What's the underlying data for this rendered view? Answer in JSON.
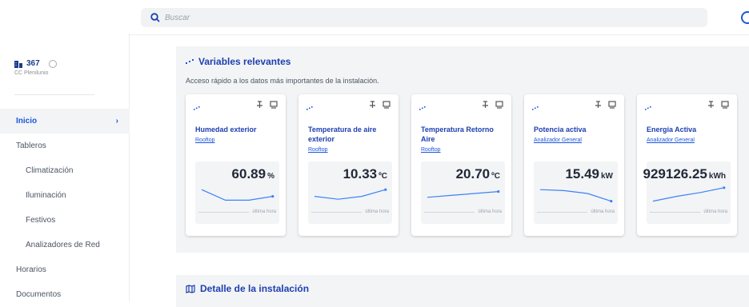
{
  "search": {
    "placeholder": "Buscar"
  },
  "site": {
    "number": "367",
    "name": "CC Plenilunio"
  },
  "nav": {
    "items": [
      {
        "label": "Inicio",
        "chevron": "›"
      },
      {
        "label": "Tableros"
      },
      {
        "label": "Climatización"
      },
      {
        "label": "Iluminación"
      },
      {
        "label": "Festivos"
      },
      {
        "label": "Analizadores de Red"
      },
      {
        "label": "Horarios"
      },
      {
        "label": "Documentos"
      }
    ]
  },
  "relevant": {
    "title": "Variables relevantes",
    "subtitle": "Acceso rápido a los datos más importantes de la instalación.",
    "cards": [
      {
        "title": "Humedad exterior",
        "link": "Rooftop",
        "value": "60.89",
        "unit": "%",
        "footer": "última hora",
        "trend": [
          0.7,
          0.15,
          0.15,
          0.35
        ]
      },
      {
        "title": "Temperatura de aire exterior",
        "link": "Rooftop",
        "value": "10.33",
        "unit": "ºC",
        "footer": "última hora",
        "trend": [
          0.35,
          0.2,
          0.35,
          0.7
        ]
      },
      {
        "title": "Temperatura Retorno Aire",
        "link": "Rooftop",
        "value": "20.70",
        "unit": "ºC",
        "footer": "última hora",
        "trend": [
          0.3,
          0.4,
          0.5,
          0.6
        ]
      },
      {
        "title": "Potencia activa",
        "link": "Analizador General",
        "value": "15.49",
        "unit": "kW",
        "footer": "última hora",
        "trend": [
          0.7,
          0.65,
          0.5,
          0.1
        ]
      },
      {
        "title": "Energía Activa",
        "link": "Analizador General",
        "value": "929126.25",
        "unit": "kWh",
        "footer": "última hora",
        "trend": [
          0.1,
          0.35,
          0.55,
          0.8
        ]
      }
    ]
  },
  "detail": {
    "title": "Detalle de la instalación"
  },
  "colors": {
    "accent": "#1a56db",
    "title": "#1e40af",
    "line": "#3b82f6"
  },
  "icons": {
    "search": "search-icon",
    "user": "user-circle-icon",
    "building": "building-icon",
    "info": "info-icon",
    "signal": "signal-icon",
    "pin": "pin-icon",
    "monitor": "monitor-icon",
    "map": "map-icon"
  }
}
